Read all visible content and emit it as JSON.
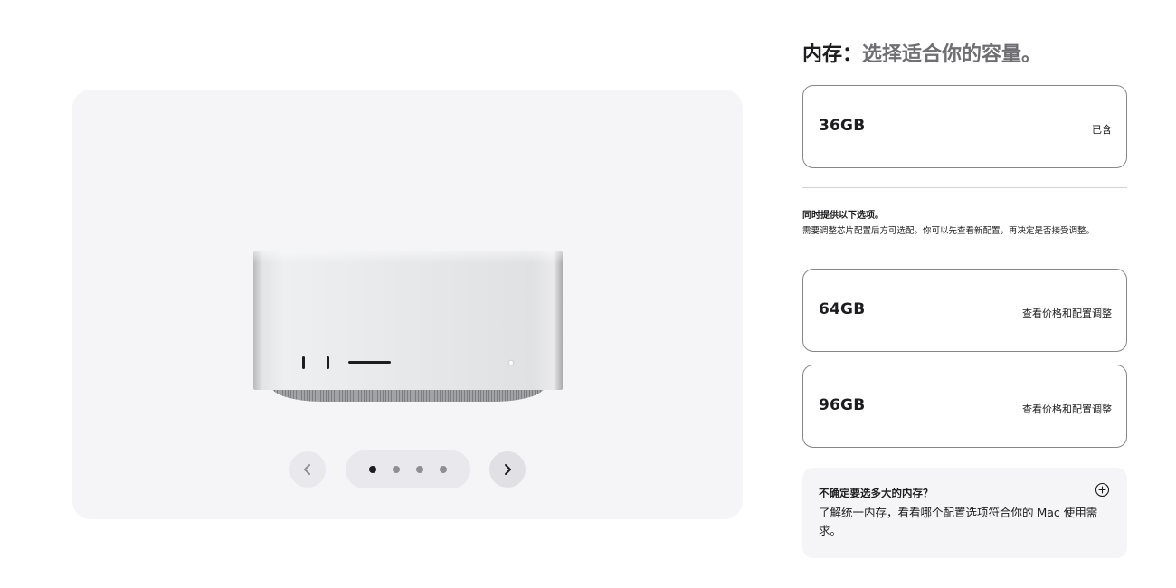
{
  "gallery": {
    "prev_label": "上一张",
    "next_label": "下一张",
    "dots": [
      {
        "active": true
      },
      {
        "active": false
      },
      {
        "active": false
      },
      {
        "active": false
      }
    ]
  },
  "memory": {
    "heading_main": "内存：",
    "heading_sub": "选择适合你的容量。",
    "included_option": {
      "capacity": "36GB",
      "note": "已含"
    },
    "also_title": "同时提供以下选项。",
    "also_desc": "需要调整芯片配置后方可选配。你可以先查看新配置，再决定是否接受调整。",
    "more_options": [
      {
        "capacity": "64GB",
        "note": "查看价格和配置调整"
      },
      {
        "capacity": "96GB",
        "note": "查看价格和配置调整"
      }
    ],
    "help": {
      "title": "不确定要选多大的内存？",
      "text": "了解统一内存，看看哪个配置选项符合你的 Mac 使用需求。"
    }
  },
  "colors": {
    "text": "#1d1d1f",
    "secondary": "#6e6e73",
    "panel": "#f5f5f7",
    "border": "#86868b"
  }
}
